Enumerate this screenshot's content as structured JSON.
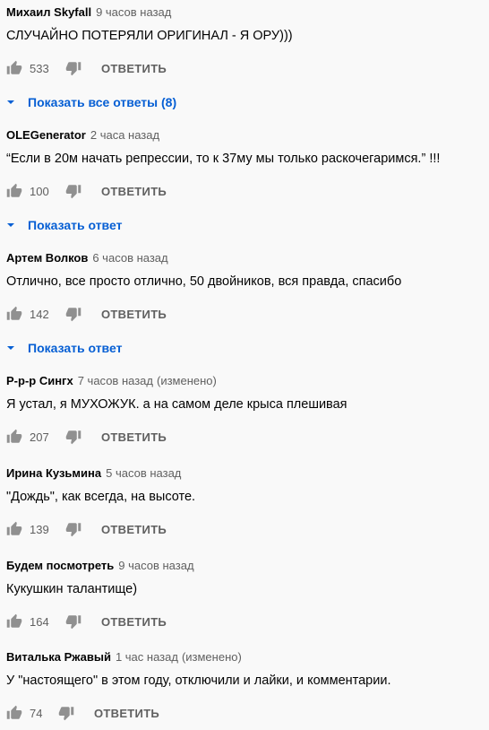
{
  "comments": [
    {
      "author": "Михаил Skyfall",
      "time": "9 часов назад",
      "edited": "",
      "text": "СЛУЧАЙНО ПОТЕРЯЛИ ОРИГИНАЛ - Я ОРУ)))",
      "likes": "533",
      "reply": "ОТВЕТИТЬ",
      "replies": "Показать все ответы (8)"
    },
    {
      "author": "OLEGenerator",
      "time": "2 часа назад",
      "edited": "",
      "text": "“Если в 20м начать репрессии, то к 37му мы только раскочегаримся.” !!!",
      "likes": "100",
      "reply": "ОТВЕТИТЬ",
      "replies": "Показать ответ"
    },
    {
      "author": "Артем Волков",
      "time": "6 часов назад",
      "edited": "",
      "text": "Отлично, все просто отлично, 50 двойников, вся правда, спасибо",
      "likes": "142",
      "reply": "ОТВЕТИТЬ",
      "replies": "Показать ответ"
    },
    {
      "author": "Р-р-р Сингх",
      "time": "7 часов назад",
      "edited": "(изменено)",
      "text": "Я устал, я МУХОЖУК. а на самом деле крыса плешивая",
      "likes": "207",
      "reply": "ОТВЕТИТЬ"
    },
    {
      "author": "Ирина Кузьмина",
      "time": "5 часов назад",
      "edited": "",
      "text": "\"Дождь\", как всегда, на высоте.",
      "likes": "139",
      "reply": "ОТВЕТИТЬ"
    },
    {
      "author": "Будем посмотреть",
      "time": "9 часов назад",
      "edited": "",
      "text": "Кукушкин талантище)",
      "likes": "164",
      "reply": "ОТВЕТИТЬ"
    },
    {
      "author": "Виталька Ржавый",
      "time": "1 час назад",
      "edited": "(изменено)",
      "text": "У \"настоящего\" в этом году, отключили и лайки, и комментарии.",
      "likes": "74",
      "reply": "ОТВЕТИТЬ"
    }
  ],
  "colors": {
    "text": "#030303",
    "secondary": "#606060",
    "link": "#065fd4",
    "icon": "#909090"
  },
  "icons": {
    "like": "thumb-up-icon",
    "dislike": "thumb-down-icon",
    "expand": "chevron-down-icon"
  }
}
